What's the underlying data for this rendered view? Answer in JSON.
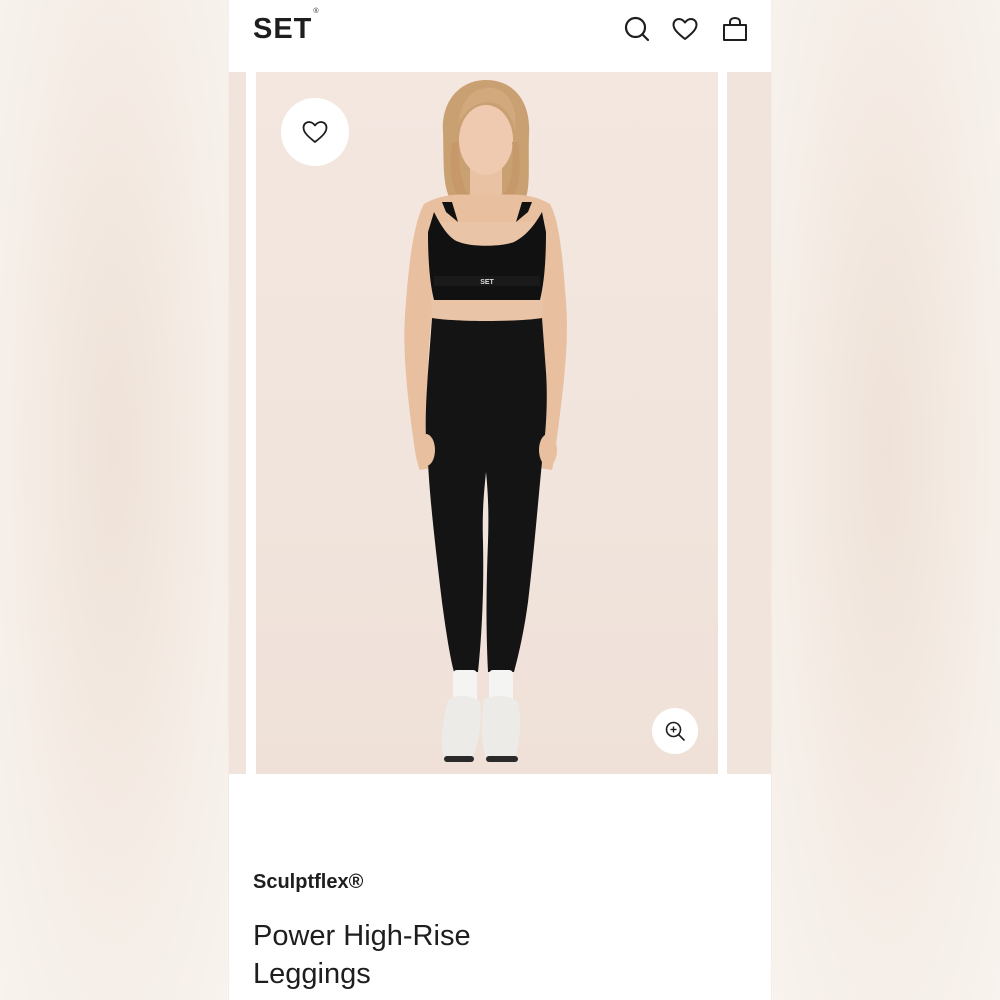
{
  "header": {
    "logo_text": "SET",
    "logo_mark": "®",
    "icons": [
      "search-icon",
      "heart-icon",
      "shopping-bag-icon"
    ]
  },
  "gallery": {
    "favorite_icon": "heart-icon",
    "zoom_icon": "zoom-in-icon",
    "bra_logo_text": "SET"
  },
  "product": {
    "collection": "Sculptflex®",
    "name": "Power High-Rise Leggings"
  },
  "colors": {
    "background": "#f6efe9",
    "image_background": "#f1e4dc",
    "text": "#1e1e1e"
  }
}
